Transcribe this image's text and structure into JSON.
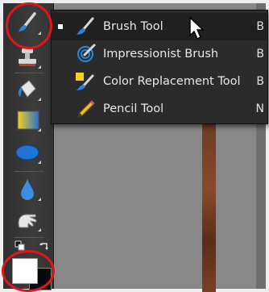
{
  "menu": {
    "items": [
      {
        "label": "Brush Tool",
        "shortcut": "B",
        "icon": "brush-icon",
        "selected": true
      },
      {
        "label": "Impressionist Brush",
        "shortcut": "B",
        "icon": "impressionist-brush-icon",
        "selected": false
      },
      {
        "label": "Color Replacement Tool",
        "shortcut": "B",
        "icon": "color-replacement-icon",
        "selected": false
      },
      {
        "label": "Pencil Tool",
        "shortcut": "N",
        "icon": "pencil-icon",
        "selected": false
      }
    ]
  },
  "toolbar": {
    "tools": [
      "brush-tool-icon",
      "clone-stamp-icon",
      "paint-bucket-icon",
      "gradient-icon",
      "ellipse-shape-icon",
      "blur-drop-icon",
      "smudge-hand-icon"
    ]
  },
  "colors": {
    "highlight": "#e4141b",
    "foreground": "#ffffff",
    "background": "#0a0a0a",
    "menu_bg": "#2b2b2b",
    "toolbar_bg": "#343434",
    "canvas_bg": "#888888"
  }
}
